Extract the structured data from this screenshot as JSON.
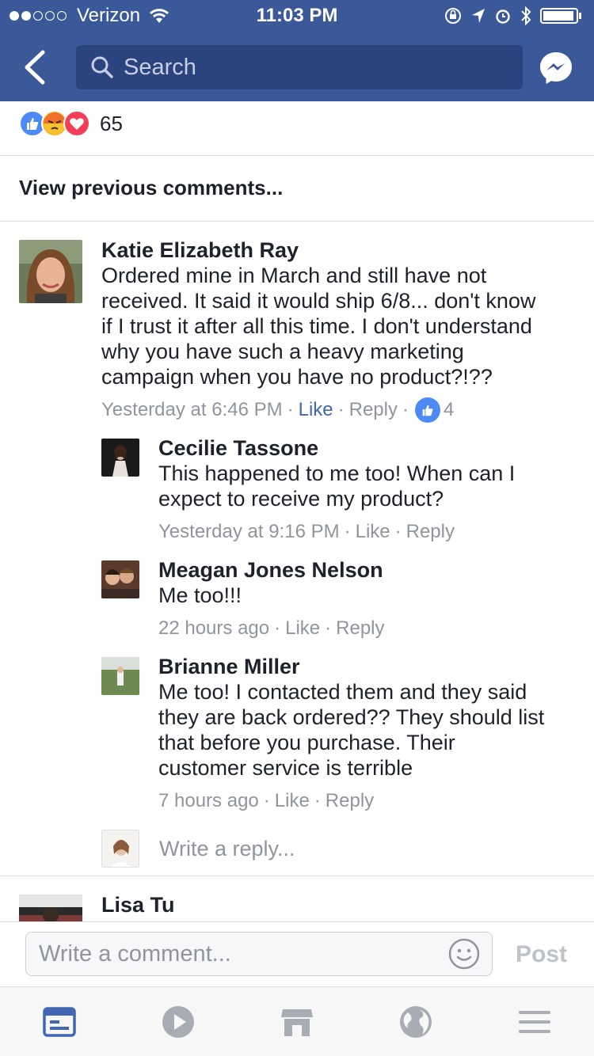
{
  "status_bar": {
    "carrier": "Verizon",
    "time": "11:03 PM"
  },
  "header": {
    "search_placeholder": "Search"
  },
  "reactions": {
    "icons": [
      "like-reaction-icon",
      "angry-reaction-icon",
      "love-reaction-icon"
    ],
    "count": "65"
  },
  "view_previous": "View previous comments...",
  "comments": [
    {
      "author": "Katie Elizabeth Ray",
      "lines": [
        "Ordered mine in March and still have not",
        "received. It said it would ship 6/8... don't know",
        "if I trust it after all this time. I don't understand",
        "why you have such a heavy marketing",
        "campaign when you have no product?!??"
      ],
      "time": "Yesterday at 6:46 PM",
      "like": "Like",
      "reply": "Reply",
      "like_count": "4"
    }
  ],
  "replies": [
    {
      "author": "Cecilie Tassone",
      "lines": [
        "This happened to me too! When can I",
        "expect to receive my product?"
      ],
      "time": "Yesterday at 9:16 PM",
      "like": "Like",
      "reply": "Reply"
    },
    {
      "author": "Meagan Jones Nelson",
      "lines": [
        "Me too!!!"
      ],
      "time": "22 hours ago",
      "like": "Like",
      "reply": "Reply"
    },
    {
      "author": "Brianne Miller",
      "lines": [
        "Me too! I contacted them and they said",
        "they are back ordered?? They should list",
        "that before you purchase. Their",
        "customer service is terrible"
      ],
      "time": "7 hours ago",
      "like": "Like",
      "reply": "Reply"
    }
  ],
  "write_reply_placeholder": "Write a reply...",
  "next_comment_author": "Lisa Tu",
  "comment_input": {
    "placeholder": "Write a comment...",
    "post_label": "Post"
  },
  "colors": {
    "brand_blue": "#3b5998",
    "link_blue": "#4267b2",
    "meta_gray": "#90949c"
  }
}
